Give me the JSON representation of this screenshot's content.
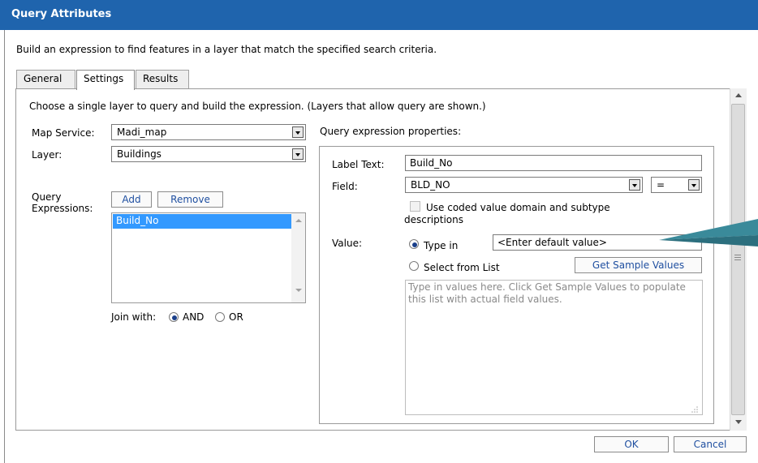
{
  "dialog": {
    "title": "Query Attributes",
    "intro": "Build an expression to find features in a layer that match the specified search criteria."
  },
  "tabs": [
    {
      "label": "General",
      "active": false
    },
    {
      "label": "Settings",
      "active": true
    },
    {
      "label": "Results",
      "active": false
    }
  ],
  "settings": {
    "instruction": "Choose a single layer to query and build the expression. (Layers that allow query are shown.)",
    "map_service_label": "Map Service:",
    "map_service_value": "Madi_map",
    "layer_label": "Layer:",
    "layer_value": "Buildings",
    "query_expr_label_1": "Query",
    "query_expr_label_2": "Expressions:",
    "add_label": "Add",
    "remove_label": "Remove",
    "expressions": [
      "Build_No"
    ],
    "join_label": "Join with:",
    "join_and": "AND",
    "join_or": "OR",
    "join_selected": "AND"
  },
  "properties": {
    "heading": "Query expression properties:",
    "label_text_label": "Label Text:",
    "label_text_value": "Build_No",
    "field_label": "Field:",
    "field_value": "BLD_NO",
    "operator_value": "=",
    "coded_domain_line1": "Use coded value domain and subtype",
    "coded_domain_line2": "descriptions",
    "coded_domain_checked": false,
    "value_label": "Value:",
    "type_in_label": "Type in",
    "type_in_placeholder": "<Enter default value>",
    "select_list_label": "Select from List",
    "selected_mode": "Type in",
    "sample_button": "Get Sample Values",
    "values_hint": "Type in values here. Click Get Sample Values to populate this list with actual field values."
  },
  "footer": {
    "ok_label": "OK",
    "cancel_label": "Cancel"
  },
  "colors": {
    "titlebar": "#1f64ad",
    "selection": "#3399ff",
    "callout": "#3a8a9a"
  }
}
